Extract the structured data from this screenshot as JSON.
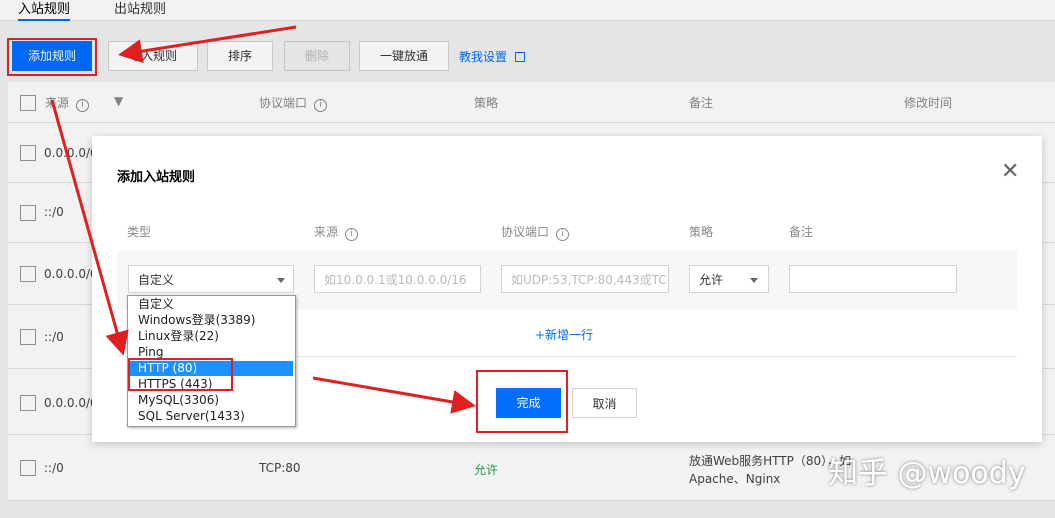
{
  "tabs": [
    {
      "label": "入站规则",
      "active": true
    },
    {
      "label": "出站规则",
      "active": false
    }
  ],
  "toolbar": {
    "add_rule": "添加规则",
    "import_rule": "导入规则",
    "sort": "排序",
    "delete": "删除",
    "allow_all": "一键放通",
    "teach_me": "教我设置"
  },
  "table": {
    "headers": {
      "source": "来源",
      "protocol_port": "协议端口",
      "policy": "策略",
      "remark": "备注",
      "modified": "修改时间"
    },
    "rows": [
      {
        "source": "0.0.0.0/0"
      },
      {
        "source": "::/0"
      },
      {
        "source": "0.0.0.0/0"
      },
      {
        "source": "::/0"
      },
      {
        "source": "0.0.0.0/0"
      },
      {
        "source": "::/0",
        "port": "TCP:80",
        "policy": "允许",
        "remark_line1": "放通Web服务HTTP（80），如",
        "remark_line2": "Apache、Nginx"
      }
    ]
  },
  "modal": {
    "title": "添加入站规则",
    "headers": {
      "type": "类型",
      "source": "来源",
      "protocol_port": "协议端口",
      "policy": "策略",
      "remark": "备注"
    },
    "type_value": "自定义",
    "source_placeholder": "如10.0.0.1或10.0.0.0/16",
    "port_placeholder": "如UDP:53,TCP:80,443或TC",
    "policy_value": "允许",
    "add_row": "+新增一行",
    "done": "完成",
    "cancel": "取消"
  },
  "dropdown": {
    "options": [
      "自定义",
      "Windows登录(3389)",
      "Linux登录(22)",
      "Ping",
      "HTTP (80)",
      "HTTPS (443)",
      "MySQL(3306)",
      "SQL Server(1433)"
    ],
    "selected": "HTTP (80)"
  },
  "watermark": "知乎 @woody",
  "colors": {
    "accent": "#006eff",
    "annotation": "#e02020",
    "allow": "#2ba14b"
  }
}
